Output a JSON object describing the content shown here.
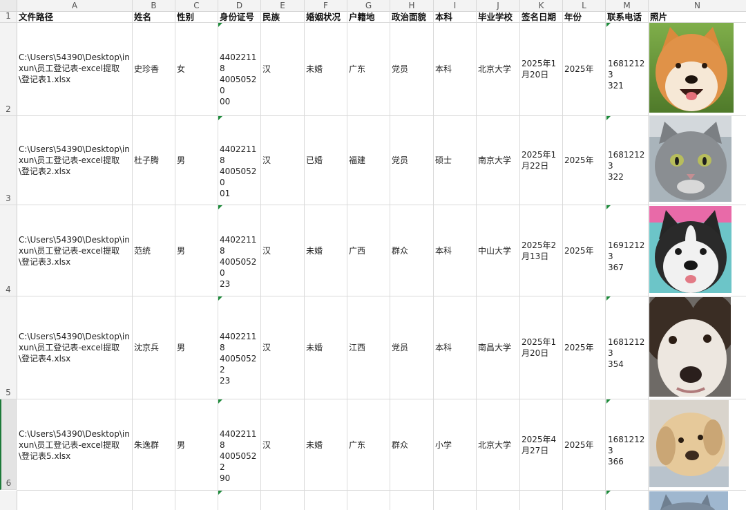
{
  "columns": [
    "A",
    "B",
    "C",
    "D",
    "E",
    "F",
    "G",
    "H",
    "I",
    "J",
    "K",
    "L",
    "M",
    "N"
  ],
  "row_numbers": [
    "1",
    "2",
    "3",
    "4",
    "5",
    "6"
  ],
  "headers": {
    "path": "文件路径",
    "name": "姓名",
    "gender": "性别",
    "id_no": "身份证号",
    "ethnicity": "民族",
    "marital": "婚姻状况",
    "hometown": "户籍地",
    "political": "政治面貌",
    "degree": "本科",
    "school": "毕业学校",
    "sign_date": "签名日期",
    "year": "年份",
    "phone": "联系电话",
    "photo": "照片"
  },
  "rows": [
    {
      "path": "C:\\Users\\54390\\Desktop\\inxun\\员工登记表-excel提取\\登记表1.xlsx",
      "name": "史珍香",
      "gender": "女",
      "id_no": "44022118\n40050520\n00",
      "ethnicity": "汉",
      "marital": "未婚",
      "hometown": "广东",
      "political": "党员",
      "degree": "本科",
      "school": "北京大学",
      "sign_date": "2025年1\n月20日",
      "year": "2025年",
      "phone": "16812123\n321",
      "photo": "shiba-dog-photo"
    },
    {
      "path": "C:\\Users\\54390\\Desktop\\inxun\\员工登记表-excel提取\\登记表2.xlsx",
      "name": "杜子腾",
      "gender": "男",
      "id_no": "44022118\n40050520\n01",
      "ethnicity": "汉",
      "marital": "已婚",
      "hometown": "福建",
      "political": "党员",
      "degree": "硕士",
      "school": "南京大学",
      "sign_date": "2025年1\n月22日",
      "year": "2025年",
      "phone": "16812123\n322",
      "photo": "gray-cat-photo"
    },
    {
      "path": "C:\\Users\\54390\\Desktop\\inxun\\员工登记表-excel提取\\登记表3.xlsx",
      "name": "范统",
      "gender": "男",
      "id_no": "44022118\n40050520\n23",
      "ethnicity": "汉",
      "marital": "未婚",
      "hometown": "广西",
      "political": "群众",
      "degree": "本科",
      "school": "中山大学",
      "sign_date": "2025年2\n月13日",
      "year": "2025年",
      "phone": "16912123\n367",
      "photo": "husky-dog-photo"
    },
    {
      "path": "C:\\Users\\54390\\Desktop\\inxun\\员工登记表-excel提取\\登记表4.xlsx",
      "name": "沈京兵",
      "gender": "男",
      "id_no": "44022118\n40050522\n23",
      "ethnicity": "汉",
      "marital": "未婚",
      "hometown": "江西",
      "political": "党员",
      "degree": "本科",
      "school": "南昌大学",
      "sign_date": "2025年1\n月20日",
      "year": "2025年",
      "phone": "16812123\n354",
      "photo": "border-collie-photo"
    },
    {
      "path": "C:\\Users\\54390\\Desktop\\inxun\\员工登记表-excel提取\\登记表5.xlsx",
      "name": "朱逸群",
      "gender": "男",
      "id_no": "44022118\n40050522\n90",
      "ethnicity": "汉",
      "marital": "未婚",
      "hometown": "广东",
      "political": "群众",
      "degree": "小学",
      "school": "北京大学",
      "sign_date": "2025年4\n月27日",
      "year": "2025年",
      "phone": "16812123\n366",
      "photo": "labrador-dog-photo"
    }
  ]
}
